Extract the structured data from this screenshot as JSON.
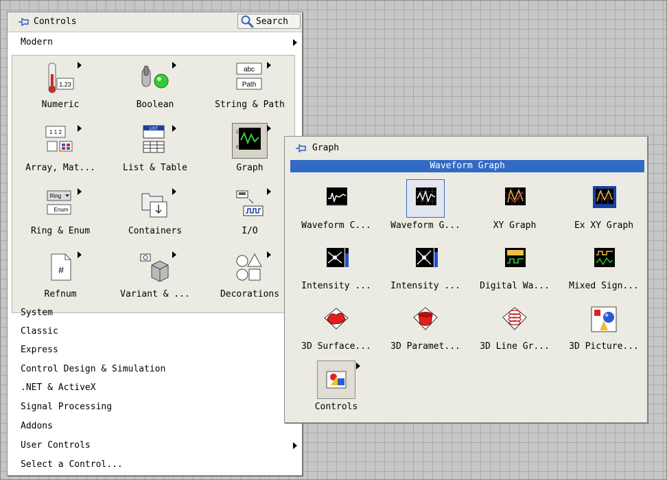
{
  "controls_palette": {
    "title": "Controls",
    "search_label": "Search",
    "modern_label": "Modern",
    "modern_items": [
      {
        "label": "Numeric",
        "icon": "numeric-icon"
      },
      {
        "label": "Boolean",
        "icon": "boolean-icon"
      },
      {
        "label": "String & Path",
        "icon": "string-path-icon"
      },
      {
        "label": "Array, Mat...",
        "icon": "array-matrix-icon"
      },
      {
        "label": "List & Table",
        "icon": "list-table-icon"
      },
      {
        "label": "Graph",
        "icon": "graph-icon"
      },
      {
        "label": "Ring & Enum",
        "icon": "ring-enum-icon"
      },
      {
        "label": "Containers",
        "icon": "containers-icon"
      },
      {
        "label": "I/O",
        "icon": "io-icon"
      },
      {
        "label": "Refnum",
        "icon": "refnum-icon"
      },
      {
        "label": "Variant & ...",
        "icon": "variant-class-icon"
      },
      {
        "label": "Decorations",
        "icon": "decorations-icon"
      }
    ],
    "categories": [
      {
        "label": "System",
        "has_submenu": false
      },
      {
        "label": "Classic",
        "has_submenu": false
      },
      {
        "label": "Express",
        "has_submenu": false
      },
      {
        "label": "Control Design & Simulation",
        "has_submenu": false
      },
      {
        "label": ".NET & ActiveX",
        "has_submenu": false
      },
      {
        "label": "Signal Processing",
        "has_submenu": false
      },
      {
        "label": "Addons",
        "has_submenu": false
      },
      {
        "label": "User Controls",
        "has_submenu": true
      },
      {
        "label": "Select a Control...",
        "has_submenu": false
      }
    ]
  },
  "graph_palette": {
    "title": "Graph",
    "selected_item": "Waveform Graph",
    "items": [
      {
        "label": "Waveform C...",
        "icon": "waveform-chart-icon"
      },
      {
        "label": "Waveform G...",
        "icon": "waveform-graph-icon"
      },
      {
        "label": "XY Graph",
        "icon": "xy-graph-icon"
      },
      {
        "label": "Ex XY Graph",
        "icon": "ex-xy-graph-icon"
      },
      {
        "label": "Intensity ...",
        "icon": "intensity-chart-icon"
      },
      {
        "label": "Intensity ...",
        "icon": "intensity-graph-icon"
      },
      {
        "label": "Digital Wa...",
        "icon": "digital-waveform-icon"
      },
      {
        "label": "Mixed Sign...",
        "icon": "mixed-signal-icon"
      },
      {
        "label": "3D Surface...",
        "icon": "3d-surface-icon"
      },
      {
        "label": "3D Paramet...",
        "icon": "3d-parametric-icon"
      },
      {
        "label": "3D Line Gr...",
        "icon": "3d-line-graph-icon"
      },
      {
        "label": "3D Picture...",
        "icon": "3d-picture-icon"
      },
      {
        "label": "Controls",
        "icon": "controls-subpalette-icon"
      }
    ]
  },
  "colors": {
    "selection": "#316ac5",
    "palette_bg": "#ecebe3",
    "grid_bg": "#c6c6c6"
  }
}
